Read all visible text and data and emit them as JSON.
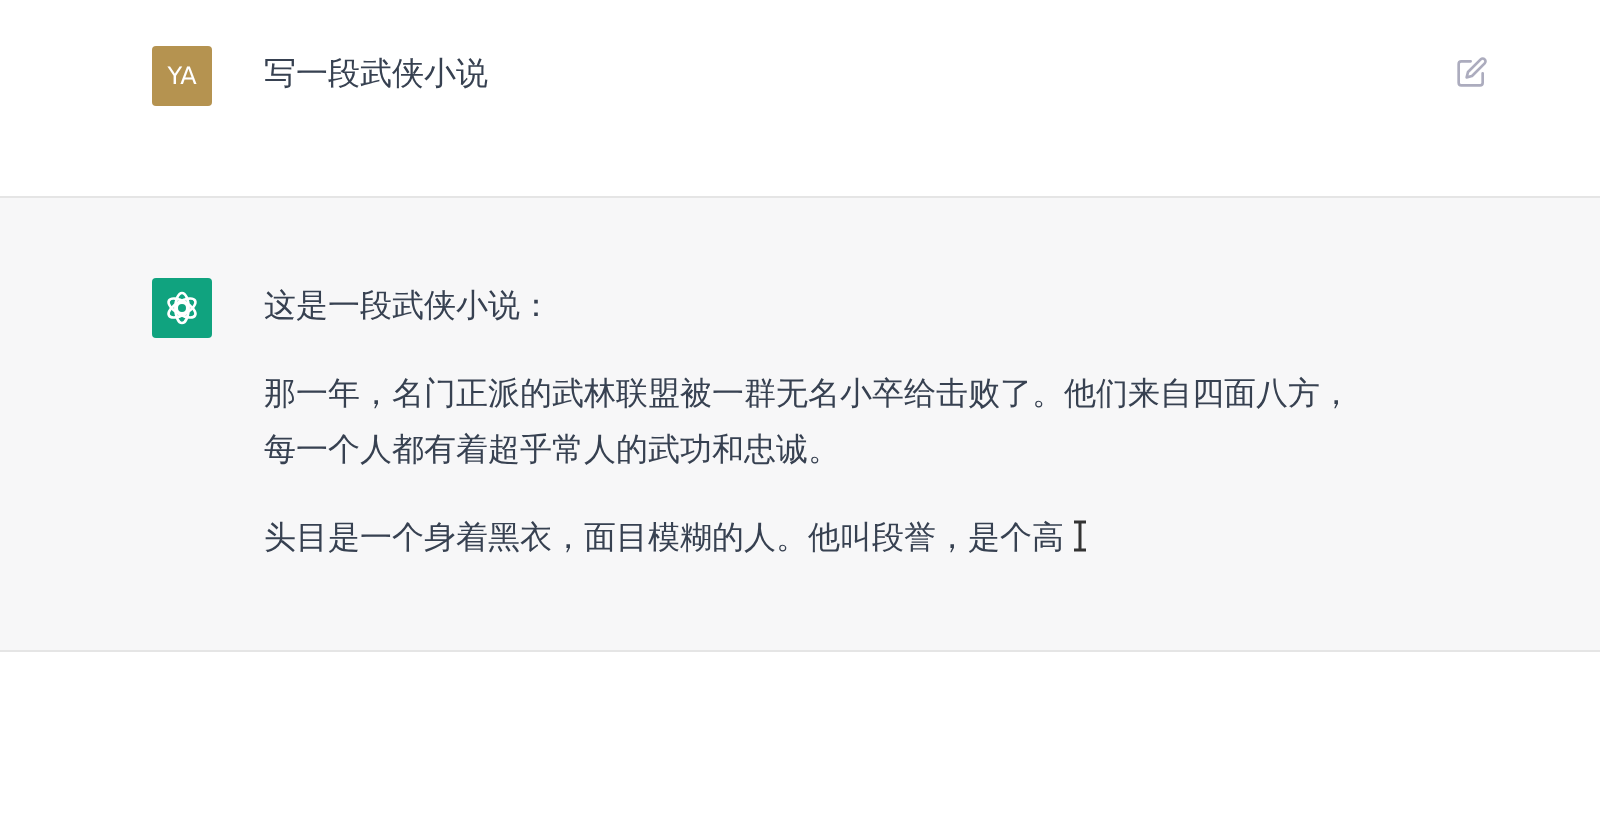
{
  "messages": [
    {
      "kind": "user",
      "avatar": "YA",
      "paragraphs": [
        "写一段武侠小说"
      ]
    },
    {
      "kind": "assistant",
      "paragraphs": [
        "这是一段武侠小说：",
        "那一年，名门正派的武林联盟被一群无名小卒给击败了。他们来自四面八方，每一个人都有着超乎常人的武功和忠诚。",
        "头目是一个身着黑衣，面目模糊的人。他叫段誉，是个高"
      ]
    }
  ]
}
